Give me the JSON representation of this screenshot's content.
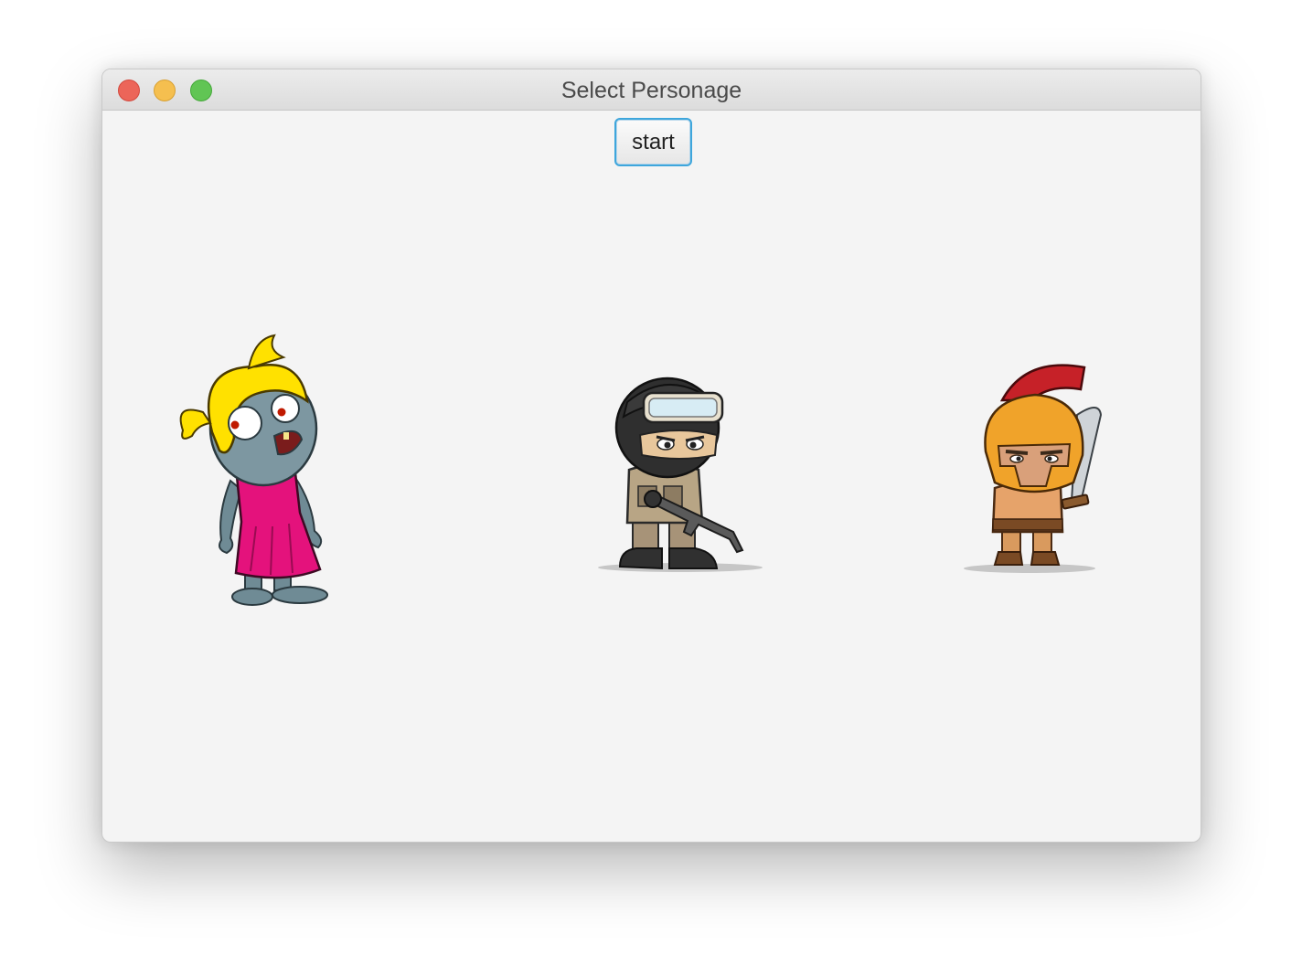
{
  "window": {
    "title": "Select Personage"
  },
  "toolbar": {
    "start_label": "start"
  },
  "characters": [
    {
      "name": "zombie-girl",
      "icon": "zombie-girl-icon"
    },
    {
      "name": "soldier",
      "icon": "soldier-icon"
    },
    {
      "name": "spartan",
      "icon": "spartan-icon"
    }
  ],
  "colors": {
    "focus_ring": "#3ea6dc",
    "window_bg": "#f4f4f4",
    "close": "#ec6559",
    "minimize": "#f5bf4f",
    "maximize": "#61c554"
  }
}
